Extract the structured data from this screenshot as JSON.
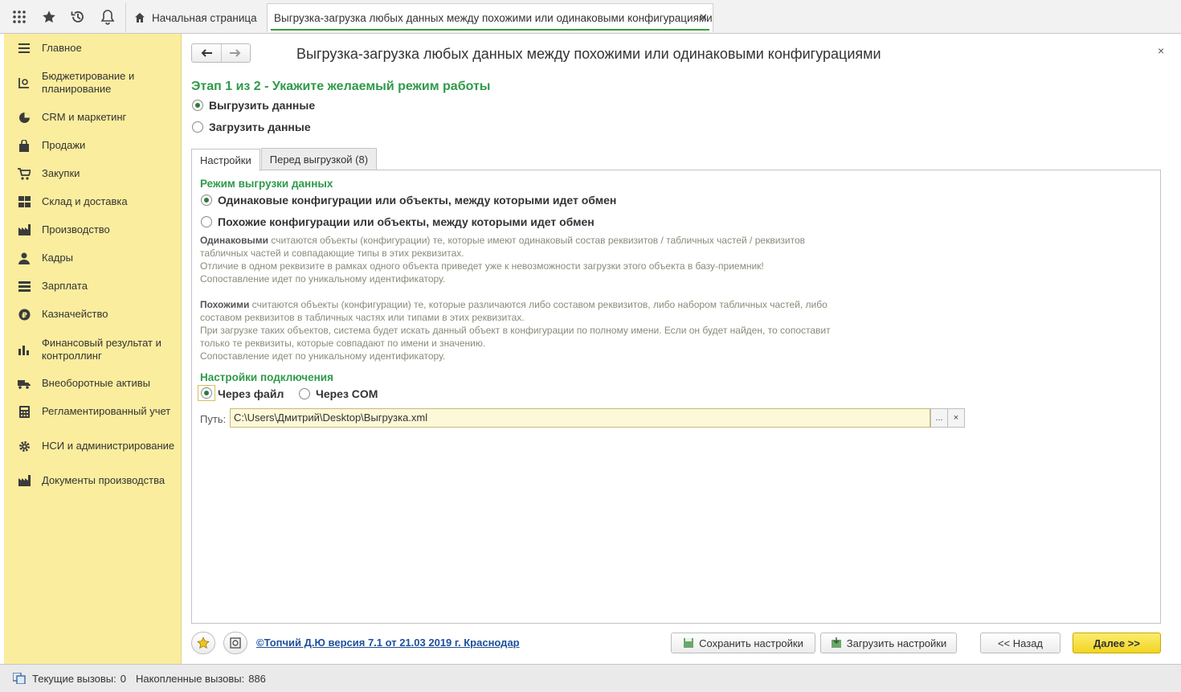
{
  "topbar": {
    "home_tab": "Начальная страница",
    "active_tab": "Выгрузка-загрузка любых данных между похожими или одинаковыми конфигурациями",
    "close_glyph": "✕"
  },
  "sidebar": {
    "items": [
      {
        "label": "Главное",
        "icon": "menu-icon"
      },
      {
        "label": "Бюджетирование и планирование",
        "icon": "budget-icon"
      },
      {
        "label": "CRM и маркетинг",
        "icon": "pie-chart-icon"
      },
      {
        "label": "Продажи",
        "icon": "bag-icon"
      },
      {
        "label": "Закупки",
        "icon": "cart-icon"
      },
      {
        "label": "Склад и доставка",
        "icon": "warehouse-icon"
      },
      {
        "label": "Производство",
        "icon": "factory-icon"
      },
      {
        "label": "Кадры",
        "icon": "person-icon"
      },
      {
        "label": "Зарплата",
        "icon": "payroll-icon"
      },
      {
        "label": "Казначейство",
        "icon": "ruble-icon"
      },
      {
        "label": "Финансовый результат и контроллинг",
        "icon": "bar-chart-icon"
      },
      {
        "label": "Внеоборотные активы",
        "icon": "truck-icon"
      },
      {
        "label": "Регламентированный учет",
        "icon": "calculator-icon"
      },
      {
        "label": "НСИ и администрирование",
        "icon": "gear-icon"
      },
      {
        "label": "Документы производства",
        "icon": "document-factory-icon"
      }
    ]
  },
  "form": {
    "title": "Выгрузка-загрузка любых данных между похожими или одинаковыми конфигурациями",
    "close_glyph": "×",
    "stage": "Этап 1 из 2 - Укажите желаемый режим работы",
    "mode_options": [
      "Выгрузить данные",
      "Загрузить данные"
    ],
    "mode_selected": 0,
    "tabs": [
      "Настройки",
      "Перед выгрузкой (8)"
    ],
    "export_mode_title": "Режим выгрузки данных",
    "export_options": [
      "Одинаковые конфигурации или объекты, между которыми идет обмен",
      "Похожие конфигурации или объекты, между которыми идет обмен"
    ],
    "export_selected": 0,
    "desc_same": {
      "bold": "Одинаковыми",
      "line1": " считаются объекты (конфигурации) те, которые имеют одинаковый состав реквизитов / табличных частей / реквизитов",
      "line2": "табличных частей и совпадающие типы в этих реквизитах.",
      "line3": "Отличие в одном реквизите в рамках одного объекта приведет уже к невозможности загрузки этого объекта в базу-приемник!",
      "line4": "Сопоставление идет по уникальному идентификатору."
    },
    "desc_similar": {
      "bold": "Похожими",
      "line1": " считаются объекты (конфигурации) те, которые различаются либо составом реквизитов, либо набором табличных частей, либо",
      "line2": "составом реквизитов в табличных частях или типами в этих реквизитах.",
      "line3": "При загрузке таких объектов, система будет искать данный объект в конфигурации по полному имени. Если он будет найден, то сопоставит",
      "line4": "только те реквизиты, которые совпадают по имени и значению.",
      "line5": "Сопоставление идет по уникальному идентификатору."
    },
    "connection_title": "Настройки подключения",
    "connection_options": [
      "Через файл",
      "Через COM"
    ],
    "connection_selected": 0,
    "path_label": "Путь:",
    "path_value": "C:\\Users\\Дмитрий\\Desktop\\Выгрузка.xml",
    "path_select_btn": "...",
    "path_clear_btn": "×"
  },
  "bottom": {
    "author_link": "©Топчий Д.Ю версия 7.1 от 21.03 2019 г. Краснодар",
    "save_settings": "Сохранить настройки",
    "load_settings": "Загрузить настройки",
    "back": "<< Назад",
    "next": "Далее >>"
  },
  "status": {
    "current_calls_label": "Текущие вызовы:",
    "current_calls": "0",
    "accumulated_calls_label": "Накопленные вызовы:",
    "accumulated_calls": "886"
  },
  "colors": {
    "sidebar_bg": "#fbed9e",
    "accent_green": "#2f9a4a",
    "input_bg": "#fdf8d7",
    "primary_button": "#f2d521"
  }
}
